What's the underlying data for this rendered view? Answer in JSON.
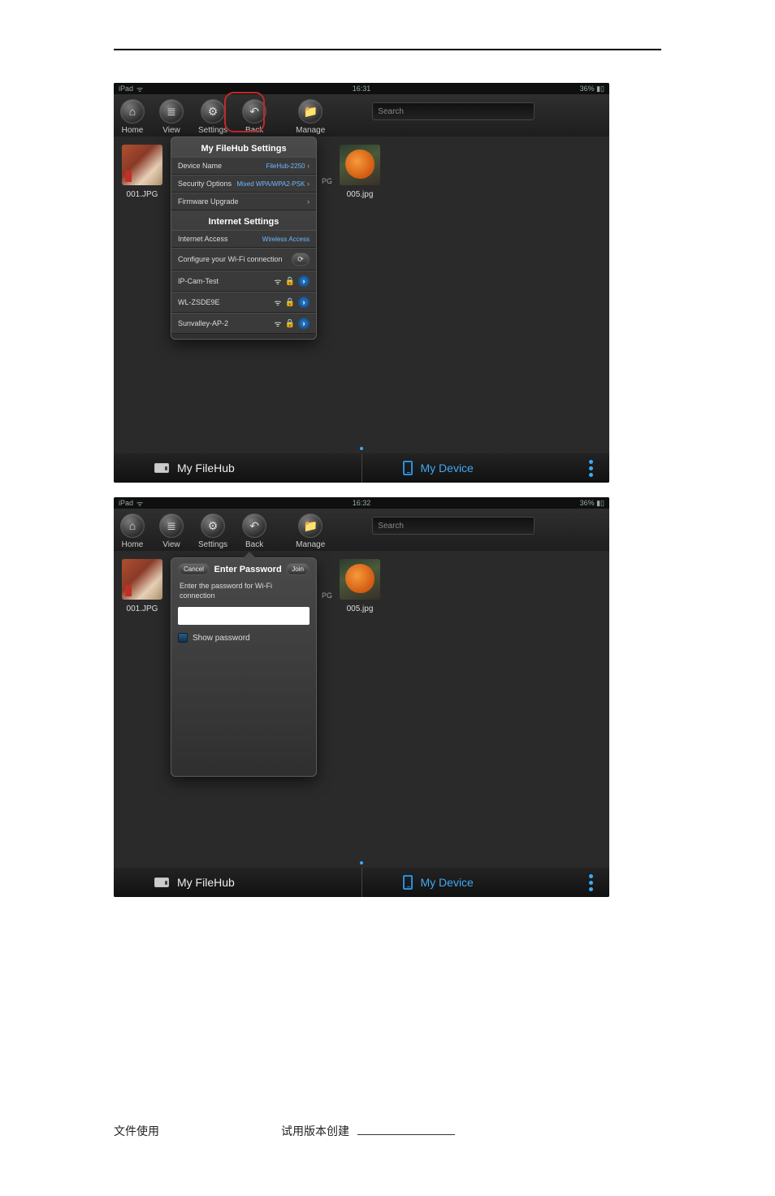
{
  "statusbar": {
    "device": "iPad",
    "time1": "16:31",
    "time2": "16:32",
    "battery": "36%"
  },
  "toolbar": {
    "home": "Home",
    "view": "View",
    "settings": "Settings",
    "back": "Back",
    "manage": "Manage",
    "search_placeholder": "Search"
  },
  "thumbs": {
    "t1": "001.JPG",
    "pg_suffix": "PG",
    "t3": "005.jpg"
  },
  "panel": {
    "header1": "My FileHub Settings",
    "device_name_label": "Device Name",
    "device_name_value": "FileHub-2250",
    "security_label": "Security Options",
    "security_value": "Mixed WPA/WPA2-PSK",
    "firmware_label": "Firmware Upgrade",
    "header2": "Internet Settings",
    "internet_access_label": "Internet Access",
    "internet_access_value": "Wireless Access",
    "configure_label": "Configure your Wi-Fi connection",
    "wifi1": "IP-Cam-Test",
    "wifi2": "WL-ZSDE9E",
    "wifi3": "Sunvalley-AP-2"
  },
  "popover": {
    "cancel": "Cancel",
    "title": "Enter Password",
    "join": "Join",
    "message": "Enter the password for Wi-Fi connection",
    "show_pw": "Show password"
  },
  "bottombar": {
    "filehub": "My FileHub",
    "device": "My Device"
  },
  "footer": {
    "left": "文件使用",
    "right": "试用版本创建"
  }
}
